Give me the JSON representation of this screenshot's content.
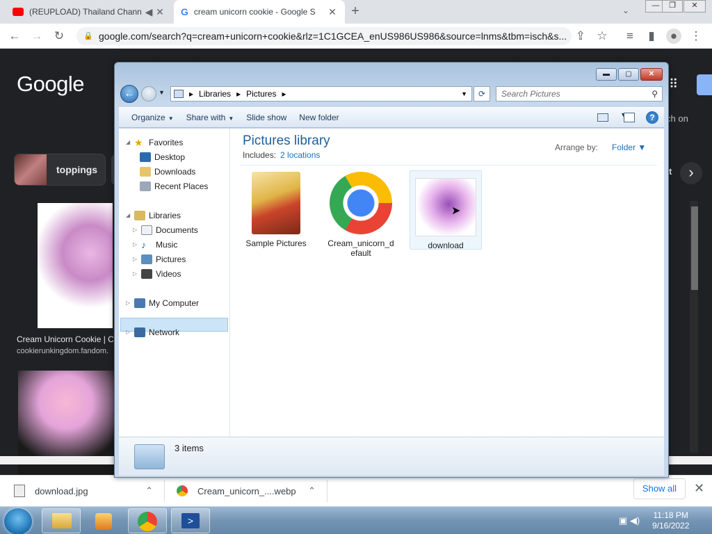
{
  "browser": {
    "tabs": [
      {
        "title": "(REUPLOAD) Thailand Chann"
      },
      {
        "title": "cream unicorn cookie - Google S"
      }
    ],
    "url": "google.com/search?q=cream+unicorn+cookie&rlz=1C1GCEA_enUS986US986&source=lnms&tbm=isch&s..."
  },
  "google": {
    "logo": "Google",
    "chip_label": "toppings",
    "result1_title": "Cream Unicorn Cookie | C",
    "result1_source": "cookierunkingdom.fandom.",
    "side_text": "ch on",
    "side_letter": "t"
  },
  "downloads": {
    "items": [
      {
        "name": "download.jpg"
      },
      {
        "name": "Cream_unicorn_....webp"
      }
    ],
    "show_all": "Show all"
  },
  "taskbar": {
    "time": "11:18 PM",
    "date": "9/16/2022"
  },
  "explorer": {
    "breadcrumb": [
      "Libraries",
      "Pictures"
    ],
    "search_placeholder": "Search Pictures",
    "commands": [
      "Organize",
      "Share with",
      "Slide show",
      "New folder"
    ],
    "nav": {
      "favorites": "Favorites",
      "favorite_items": [
        "Desktop",
        "Downloads",
        "Recent Places"
      ],
      "libraries": "Libraries",
      "library_items": [
        "Documents",
        "Music",
        "Pictures",
        "Videos"
      ],
      "computer": "My Computer",
      "network": "Network"
    },
    "library_title": "Pictures library",
    "includes_label": "Includes:",
    "includes_link": "2 locations",
    "arrange_label": "Arrange by:",
    "arrange_value": "Folder",
    "files": [
      {
        "name": "Sample Pictures",
        "icon": "folder-icon"
      },
      {
        "name": "Cream_unicorn_default",
        "icon": "chrome-icon"
      },
      {
        "name": "download",
        "icon": "image-thumbnail"
      }
    ],
    "status": "3 items"
  }
}
